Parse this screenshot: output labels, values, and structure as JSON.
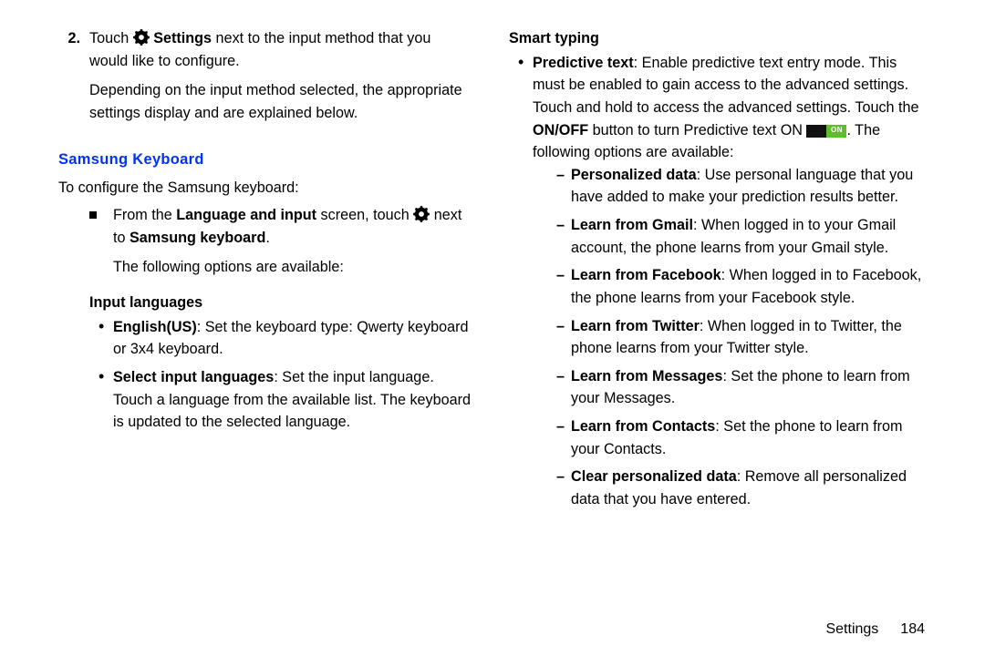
{
  "step2": {
    "num": "2.",
    "pre": "Touch ",
    "settings_bold": "Settings",
    "post": " next to the input method that you would like to configure.",
    "para2": "Depending on the input method selected, the appropriate settings display and are explained below."
  },
  "section_heading": "Samsung Keyboard",
  "intro": "To configure the Samsung keyboard:",
  "main_bullet": {
    "pre": "From the ",
    "b1": "Language and input",
    "mid": " screen, touch ",
    "post1": " next to ",
    "b2": "Samsung keyboard",
    "post2": "."
  },
  "options_note": "The following options are available:",
  "input_lang_head": "Input languages",
  "input_lang_items": [
    {
      "b": "English(US)",
      "t": ": Set the keyboard type: Qwerty keyboard or 3x4 keyboard."
    },
    {
      "b": "Select input languages",
      "t": ": Set the input language. Touch a language from the available list. The keyboard is updated to the selected language."
    }
  ],
  "smart_head": "Smart typing",
  "predictive": {
    "b": "Predictive text",
    "t1": ": Enable predictive text entry mode. This must be enabled to gain access to the advanced settings. Touch and hold to access the advanced settings. Touch the ",
    "b2": "ON/OFF",
    "t2": " button to turn Predictive text ON ",
    "on_label": "ON",
    "t3": ". The following options are available:"
  },
  "predictive_sub": [
    {
      "b": "Personalized data",
      "t": ": Use personal language that you have added to make your prediction results better."
    },
    {
      "b": "Learn from Gmail",
      "t": ": When logged in to your Gmail account, the phone learns from your Gmail style."
    },
    {
      "b": "Learn from Facebook",
      "t": ": When logged in to Facebook, the phone learns from your Facebook style."
    },
    {
      "b": "Learn from Twitter",
      "t": ": When logged in to Twitter, the phone learns from your Twitter style."
    },
    {
      "b": "Learn from Messages",
      "t": ": Set the phone to learn from your Messages."
    },
    {
      "b": "Learn from Contacts",
      "t": ": Set the phone to learn from your Contacts."
    },
    {
      "b": "Clear personalized data",
      "t": ": Remove all personalized data that you have entered."
    }
  ],
  "footer": {
    "section": "Settings",
    "page": "184"
  }
}
